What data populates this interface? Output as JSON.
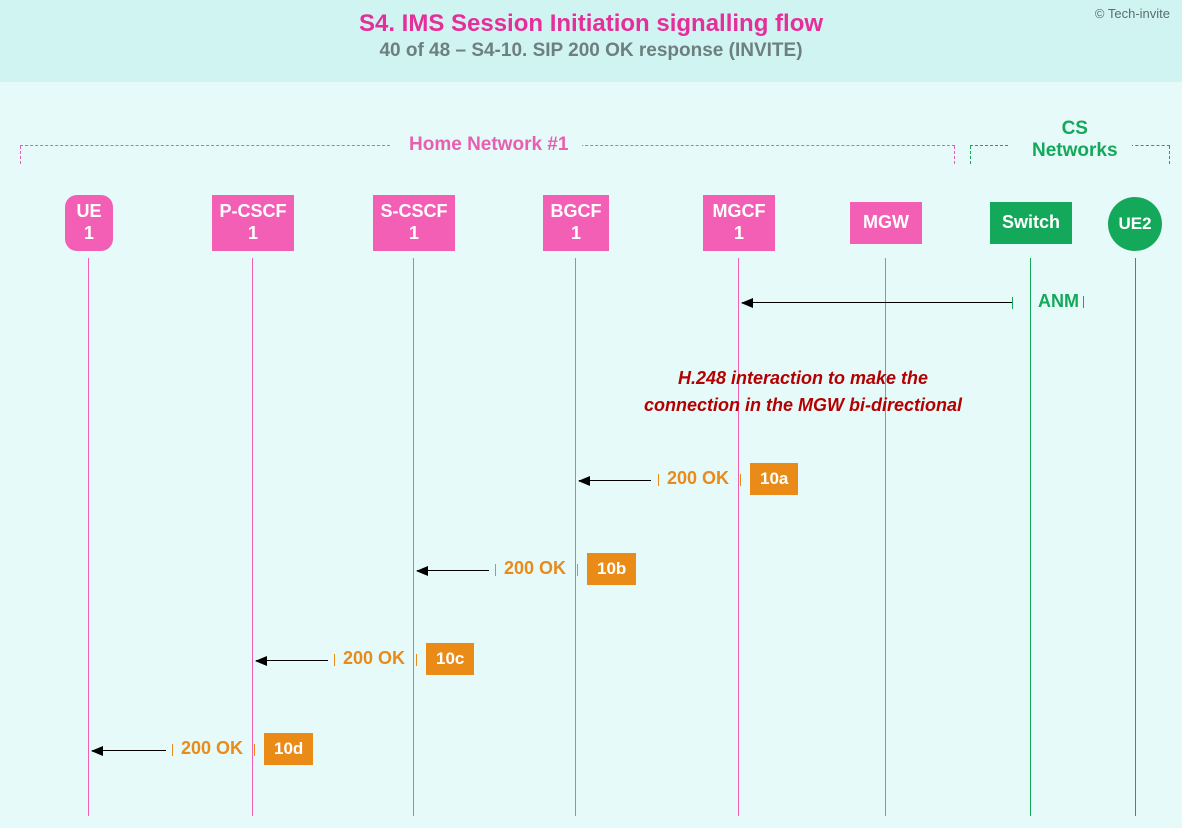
{
  "header": {
    "title": "S4. IMS Session Initiation signalling flow",
    "subtitle": "40 of 48 – S4-10. SIP 200 OK response (INVITE)",
    "copyright": "© Tech-invite"
  },
  "groups": {
    "home": "Home Network #1",
    "cs": "CS\nNetworks"
  },
  "nodes": {
    "ue1": "UE\n1",
    "pcscf": "P-CSCF\n1",
    "scscf": "S-CSCF\n1",
    "bgcf": "BGCF\n1",
    "mgcf": "MGCF\n1",
    "mgw": "MGW",
    "switch": "Switch",
    "ue2": "UE2"
  },
  "messages": {
    "anm": "ANM",
    "ok": "200 OK",
    "step_a": "10a",
    "step_b": "10b",
    "step_c": "10c",
    "step_d": "10d"
  },
  "annotation": "H.248 interaction to make the\nconnection in the MGW bi-directional"
}
